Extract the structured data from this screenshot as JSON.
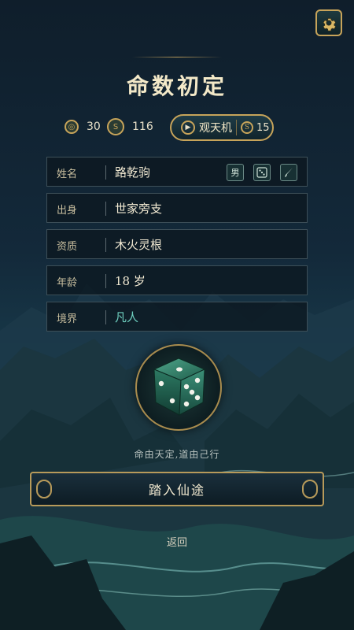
{
  "title": "命数初定",
  "currency": [
    {
      "icon": "spirit-stone-icon",
      "value": "30"
    },
    {
      "icon": "gold-coin-icon",
      "value": "116"
    }
  ],
  "guantianji": {
    "label": "观天机",
    "cost": "15",
    "icon": "play-icon"
  },
  "fields": [
    {
      "label": "姓名",
      "value": "路乾驹"
    },
    {
      "label": "出身",
      "value": "世家旁支"
    },
    {
      "label": "资质",
      "value": "木火灵根"
    },
    {
      "label": "年龄",
      "value": "18 岁"
    },
    {
      "label": "境界",
      "value": "凡人"
    }
  ],
  "name_tools": {
    "gender": "男"
  },
  "motto": "命由天定,道由己行",
  "enter_button": "踏入仙途",
  "back": "返回",
  "colors": {
    "accent_gold": "#c7a45a",
    "jade": "#6fd0c0",
    "panel": "#0c1821"
  }
}
